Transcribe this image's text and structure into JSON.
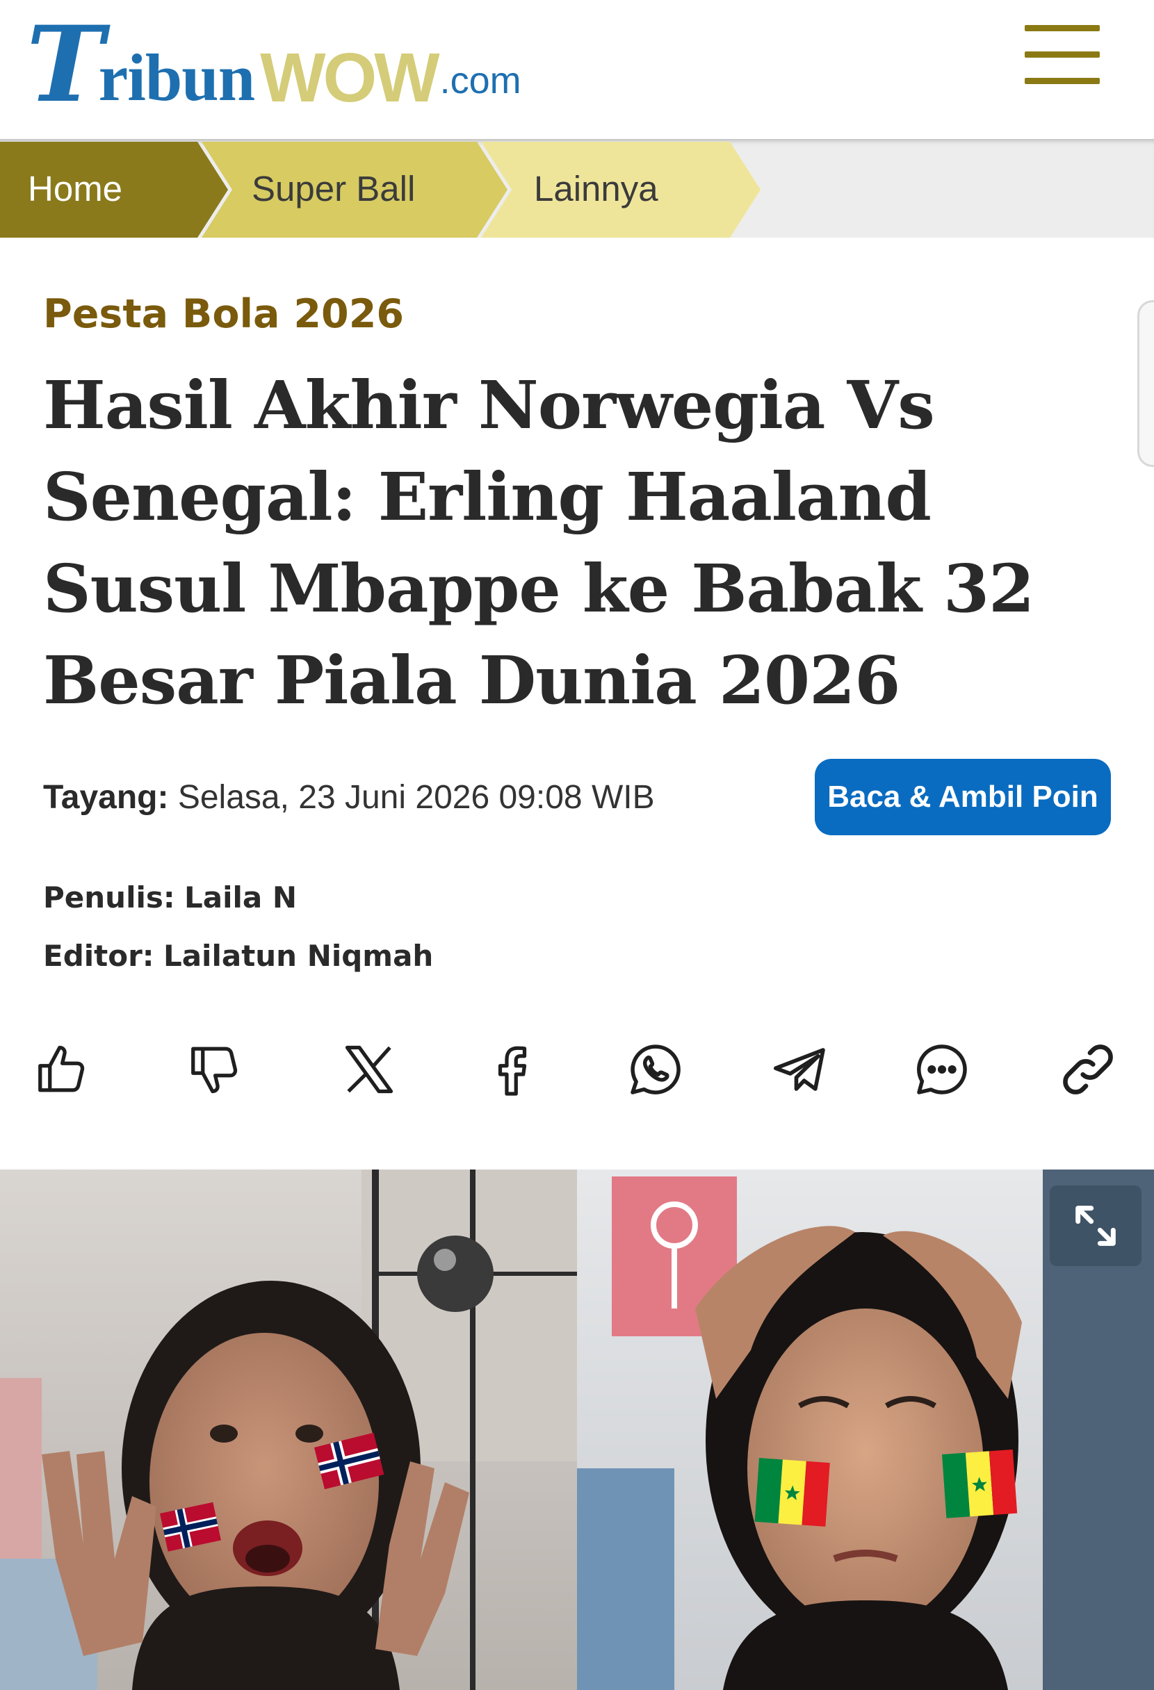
{
  "header": {
    "logo": {
      "t": "T",
      "ribun": "ribun",
      "wow": "WOW",
      "com": ".com"
    },
    "menu_icon": "hamburger-menu-icon"
  },
  "breadcrumb": [
    {
      "label": "Home"
    },
    {
      "label": "Super Ball"
    },
    {
      "label": "Lainnya"
    }
  ],
  "article": {
    "kicker": "Pesta Bola 2026",
    "title": "Hasil Akhir Norwegia Vs Senegal: Erling Haaland Susul Mbappe ke Babak 32 Besar Piala Dunia 2026",
    "published_label": "Tayang:",
    "published_value": "Selasa, 23 Juni 2026 09:08 WIB",
    "poin_button": "Baca & Ambil Poin",
    "writer_label": "Penulis:",
    "writer": "Laila N",
    "editor_label": "Editor:",
    "editor": "Lailatun Niqmah"
  },
  "share_icons": [
    "thumbs-up-icon",
    "thumbs-down-icon",
    "x-icon",
    "facebook-icon",
    "whatsapp-icon",
    "telegram-icon",
    "comment-icon",
    "link-icon"
  ],
  "colors": {
    "brand_blue": "#1e6fb0",
    "brand_gold": "#d4cc78",
    "kicker": "#7a5a0c",
    "button": "#0a6cc0",
    "crumb_home": "#8a7a1c",
    "crumb_mid": "#d7cb62",
    "crumb_light": "#efe59a"
  }
}
